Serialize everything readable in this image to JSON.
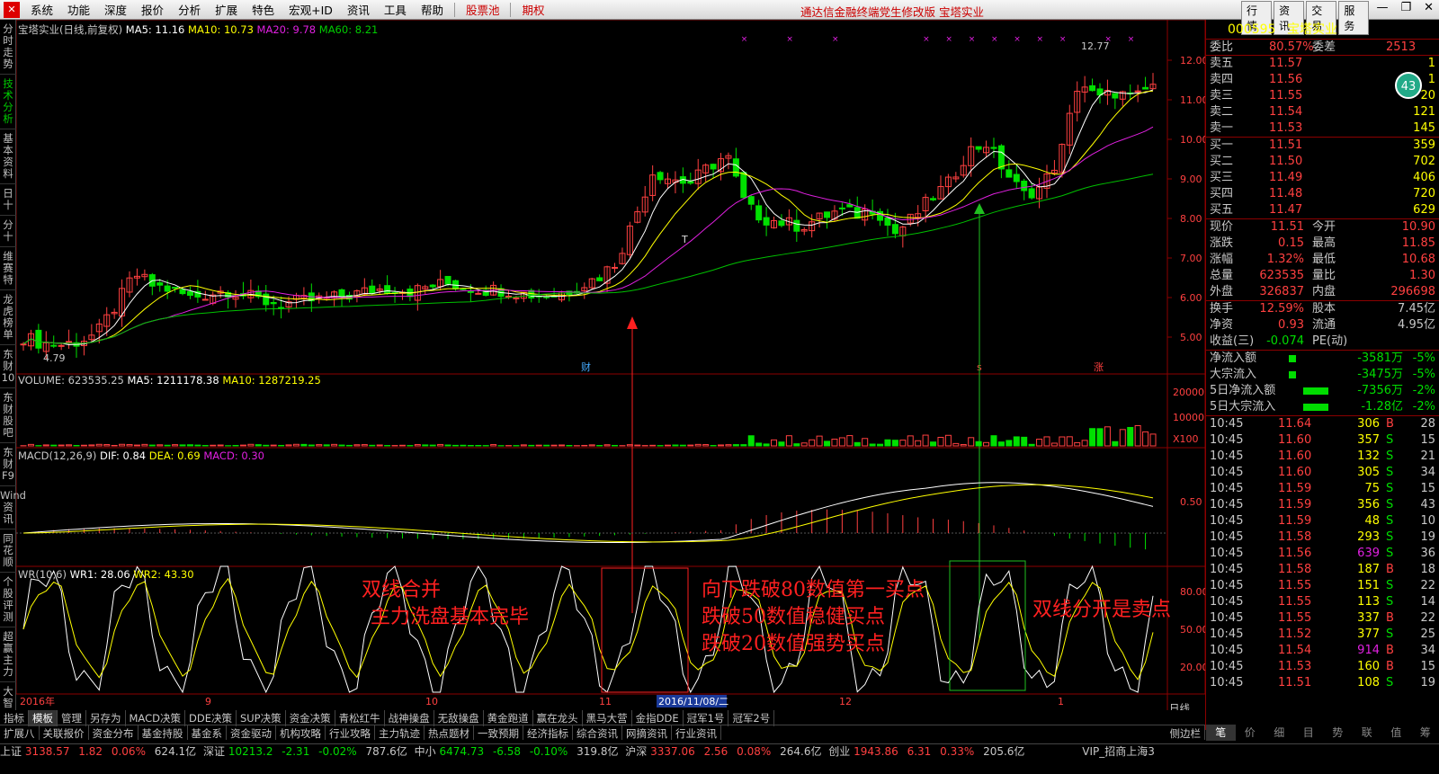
{
  "app": {
    "menus": [
      "系统",
      "功能",
      "深度",
      "报价",
      "分析",
      "扩展",
      "特色",
      "宏观+ID",
      "资讯",
      "工具",
      "帮助"
    ],
    "pool": "股票池",
    "qiquan": "期权",
    "center_title": "通达信金融终端党生修改版   宝塔实业",
    "right_buttons": [
      "行情",
      "资讯",
      "交易",
      "服务"
    ]
  },
  "left_tabs": [
    {
      "label": "分时走势",
      "on": false
    },
    {
      "label": "技术分析",
      "on": true
    },
    {
      "label": "基本资料",
      "on": false
    },
    {
      "label": "日十",
      "on": false
    },
    {
      "label": "分十",
      "on": false
    },
    {
      "label": "维赛特",
      "on": false
    },
    {
      "label": "龙虎榜单",
      "on": false
    },
    {
      "label": "东财10",
      "on": false
    },
    {
      "label": "东财股吧",
      "on": false
    },
    {
      "label": "东财F9",
      "on": false
    },
    {
      "label": "Wind资讯",
      "on": false
    },
    {
      "label": "同花顺",
      "on": false
    },
    {
      "label": "个股评测",
      "on": false
    },
    {
      "label": "超赢主力",
      "on": false
    },
    {
      "label": "大智",
      "on": false
    }
  ],
  "kline_header": {
    "name": "宝塔实业(日线,前复权)",
    "ma5": "MA5: 11.16",
    "ma10": "MA10: 10.73",
    "ma20": "MA20: 9.78",
    "ma60": "MA60: 8.21"
  },
  "volume_header": {
    "vol": "VOLUME: 623535.25",
    "ma5": "MA5: 1211178.38",
    "ma10": "MA10: 1287219.25"
  },
  "macd_header": {
    "name": "MACD(12,26,9)",
    "dif": "DIF: 0.84",
    "dea": "DEA: 0.69",
    "macd": "MACD: 0.30"
  },
  "wr_header": {
    "name": "WR(10,6)",
    "wr1": "WR1: 28.06",
    "wr2": "WR2: 43.30"
  },
  "markers": {
    "high": "12.77",
    "low": "4.79",
    "cai": "财",
    "s": "s",
    "zhang": "涨",
    "x100": "X100",
    "t": "T"
  },
  "axes": {
    "price": [
      "12.00",
      "11.00",
      "10.00",
      "9.00",
      "8.00",
      "7.00",
      "6.00",
      "5.00"
    ],
    "volume": [
      "20000",
      "10000"
    ],
    "macd": [
      "0.50"
    ],
    "wr": [
      "80.00",
      "50.00",
      "20.00"
    ],
    "dates": [
      "2016年",
      "9",
      "10",
      "11",
      "2016/11/08/二",
      "12",
      "1"
    ],
    "period": "日线",
    "side": "侧边栏"
  },
  "annotations": {
    "a1": "双线合并",
    "a2": "主力洗盘基本完毕",
    "b1": "向下跌破80数值第一买点",
    "b2": "跌破50数值稳健买点",
    "b3": "跌破20数值强势买点",
    "c1": "双线分开是卖点"
  },
  "right": {
    "code": "000595",
    "name": "宝塔实业",
    "weibi_l": "委比",
    "weibi": "80.57%",
    "weicha_l": "委差",
    "weicha": "2513",
    "circle": "43",
    "sells": [
      {
        "l": "卖五",
        "p": "11.57",
        "v": "1"
      },
      {
        "l": "卖四",
        "p": "11.56",
        "v": "1"
      },
      {
        "l": "卖三",
        "p": "11.55",
        "v": "20"
      },
      {
        "l": "卖二",
        "p": "11.54",
        "v": "121"
      },
      {
        "l": "卖一",
        "p": "11.53",
        "v": "145"
      }
    ],
    "buys": [
      {
        "l": "买一",
        "p": "11.51",
        "v": "359"
      },
      {
        "l": "买二",
        "p": "11.50",
        "v": "702"
      },
      {
        "l": "买三",
        "p": "11.49",
        "v": "406"
      },
      {
        "l": "买四",
        "p": "11.48",
        "v": "720"
      },
      {
        "l": "买五",
        "p": "11.47",
        "v": "629"
      }
    ],
    "stats": [
      [
        "现价",
        "11.51",
        "今开",
        "10.90"
      ],
      [
        "涨跌",
        "0.15",
        "最高",
        "11.85"
      ],
      [
        "涨幅",
        "1.32%",
        "最低",
        "10.68"
      ],
      [
        "总量",
        "623535",
        "量比",
        "1.30"
      ],
      [
        "外盘",
        "326837",
        "内盘",
        "296698"
      ]
    ],
    "stats2": [
      [
        "换手",
        "12.59%",
        "股本",
        "7.45亿"
      ],
      [
        "净资",
        "0.93",
        "流通",
        "4.95亿"
      ],
      [
        "收益(三)",
        "-0.074",
        "PE(动)",
        ""
      ]
    ],
    "flows": [
      [
        "净流入额",
        "-3581万",
        "-5%"
      ],
      [
        "大宗流入",
        "-3475万",
        "-5%"
      ],
      [
        "5日净流入额",
        "-7356万",
        "-2%"
      ],
      [
        "5日大宗流入",
        "-1.28亿",
        "-2%"
      ]
    ],
    "ticks": [
      [
        "10:45",
        "11.64",
        "306",
        "B",
        "28"
      ],
      [
        "10:45",
        "11.60",
        "357",
        "S",
        "15"
      ],
      [
        "10:45",
        "11.60",
        "132",
        "S",
        "21"
      ],
      [
        "10:45",
        "11.60",
        "305",
        "S",
        "34"
      ],
      [
        "10:45",
        "11.59",
        "75",
        "S",
        "15"
      ],
      [
        "10:45",
        "11.59",
        "356",
        "S",
        "43"
      ],
      [
        "10:45",
        "11.59",
        "48",
        "S",
        "10"
      ],
      [
        "10:45",
        "11.58",
        "293",
        "S",
        "19"
      ],
      [
        "10:45",
        "11.56",
        "639",
        "S",
        "36"
      ],
      [
        "10:45",
        "11.58",
        "187",
        "B",
        "18"
      ],
      [
        "10:45",
        "11.55",
        "151",
        "S",
        "22"
      ],
      [
        "10:45",
        "11.55",
        "113",
        "S",
        "14"
      ],
      [
        "10:45",
        "11.55",
        "337",
        "B",
        "22"
      ],
      [
        "10:45",
        "11.52",
        "377",
        "S",
        "25"
      ],
      [
        "10:45",
        "11.54",
        "914",
        "B",
        "34"
      ],
      [
        "10:45",
        "11.53",
        "160",
        "B",
        "15"
      ],
      [
        "10:45",
        "11.51",
        "108",
        "S",
        "19"
      ]
    ],
    "bottom_tabs": [
      "笔",
      "价",
      "细",
      "目",
      "势",
      "联",
      "值",
      "筹"
    ]
  },
  "bottom_tabs": [
    "指标",
    "模板",
    "管理",
    "另存为",
    "MACD决策",
    "DDE决策",
    "SUP决策",
    "资金决策",
    "青松红牛",
    "战神操盘",
    "无敌操盘",
    "黄金跑道",
    "赢在龙头",
    "黑马大营",
    "金指DDE",
    "冠军1号",
    "冠军2号"
  ],
  "bottom_tabs2": [
    "扩展八",
    "关联报价",
    "资金分布",
    "基金持股",
    "基金系",
    "资金驱动",
    "机构攻略",
    "行业攻略",
    "主力轨迹",
    "热点题材",
    "一致预期",
    "经济指标",
    "综合资讯",
    "网摘资讯",
    "行业资讯"
  ],
  "status": {
    "sh_l": "上证",
    "sh": "3138.57",
    "sh_c": "1.82",
    "sh_p": "0.06%",
    "sh_v": "624.1亿",
    "sz_l": "深证",
    "sz": "10213.2",
    "sz_c": "-2.31",
    "sz_p": "-0.02%",
    "sz_v": "787.6亿",
    "zx_l": "中小",
    "zx": "6474.73",
    "zx_c": "-6.58",
    "zx_p": "-0.10%",
    "zx_v": "319.8亿",
    "hs_l": "沪深",
    "hs": "3337.06",
    "hs_c": "2.56",
    "hs_p": "0.08%",
    "hs_v": "264.6亿",
    "cy_l": "创业",
    "cy": "1943.86",
    "cy_c": "6.31",
    "cy_p": "0.33%",
    "cy_v": "205.6亿",
    "vip": "VIP_招商上海3"
  },
  "colors": {
    "up": "#ff4040",
    "down": "#00e000",
    "ma5": "#ffffff",
    "ma10": "#ffff00",
    "ma20": "#e020e0",
    "ma60": "#00c000"
  }
}
